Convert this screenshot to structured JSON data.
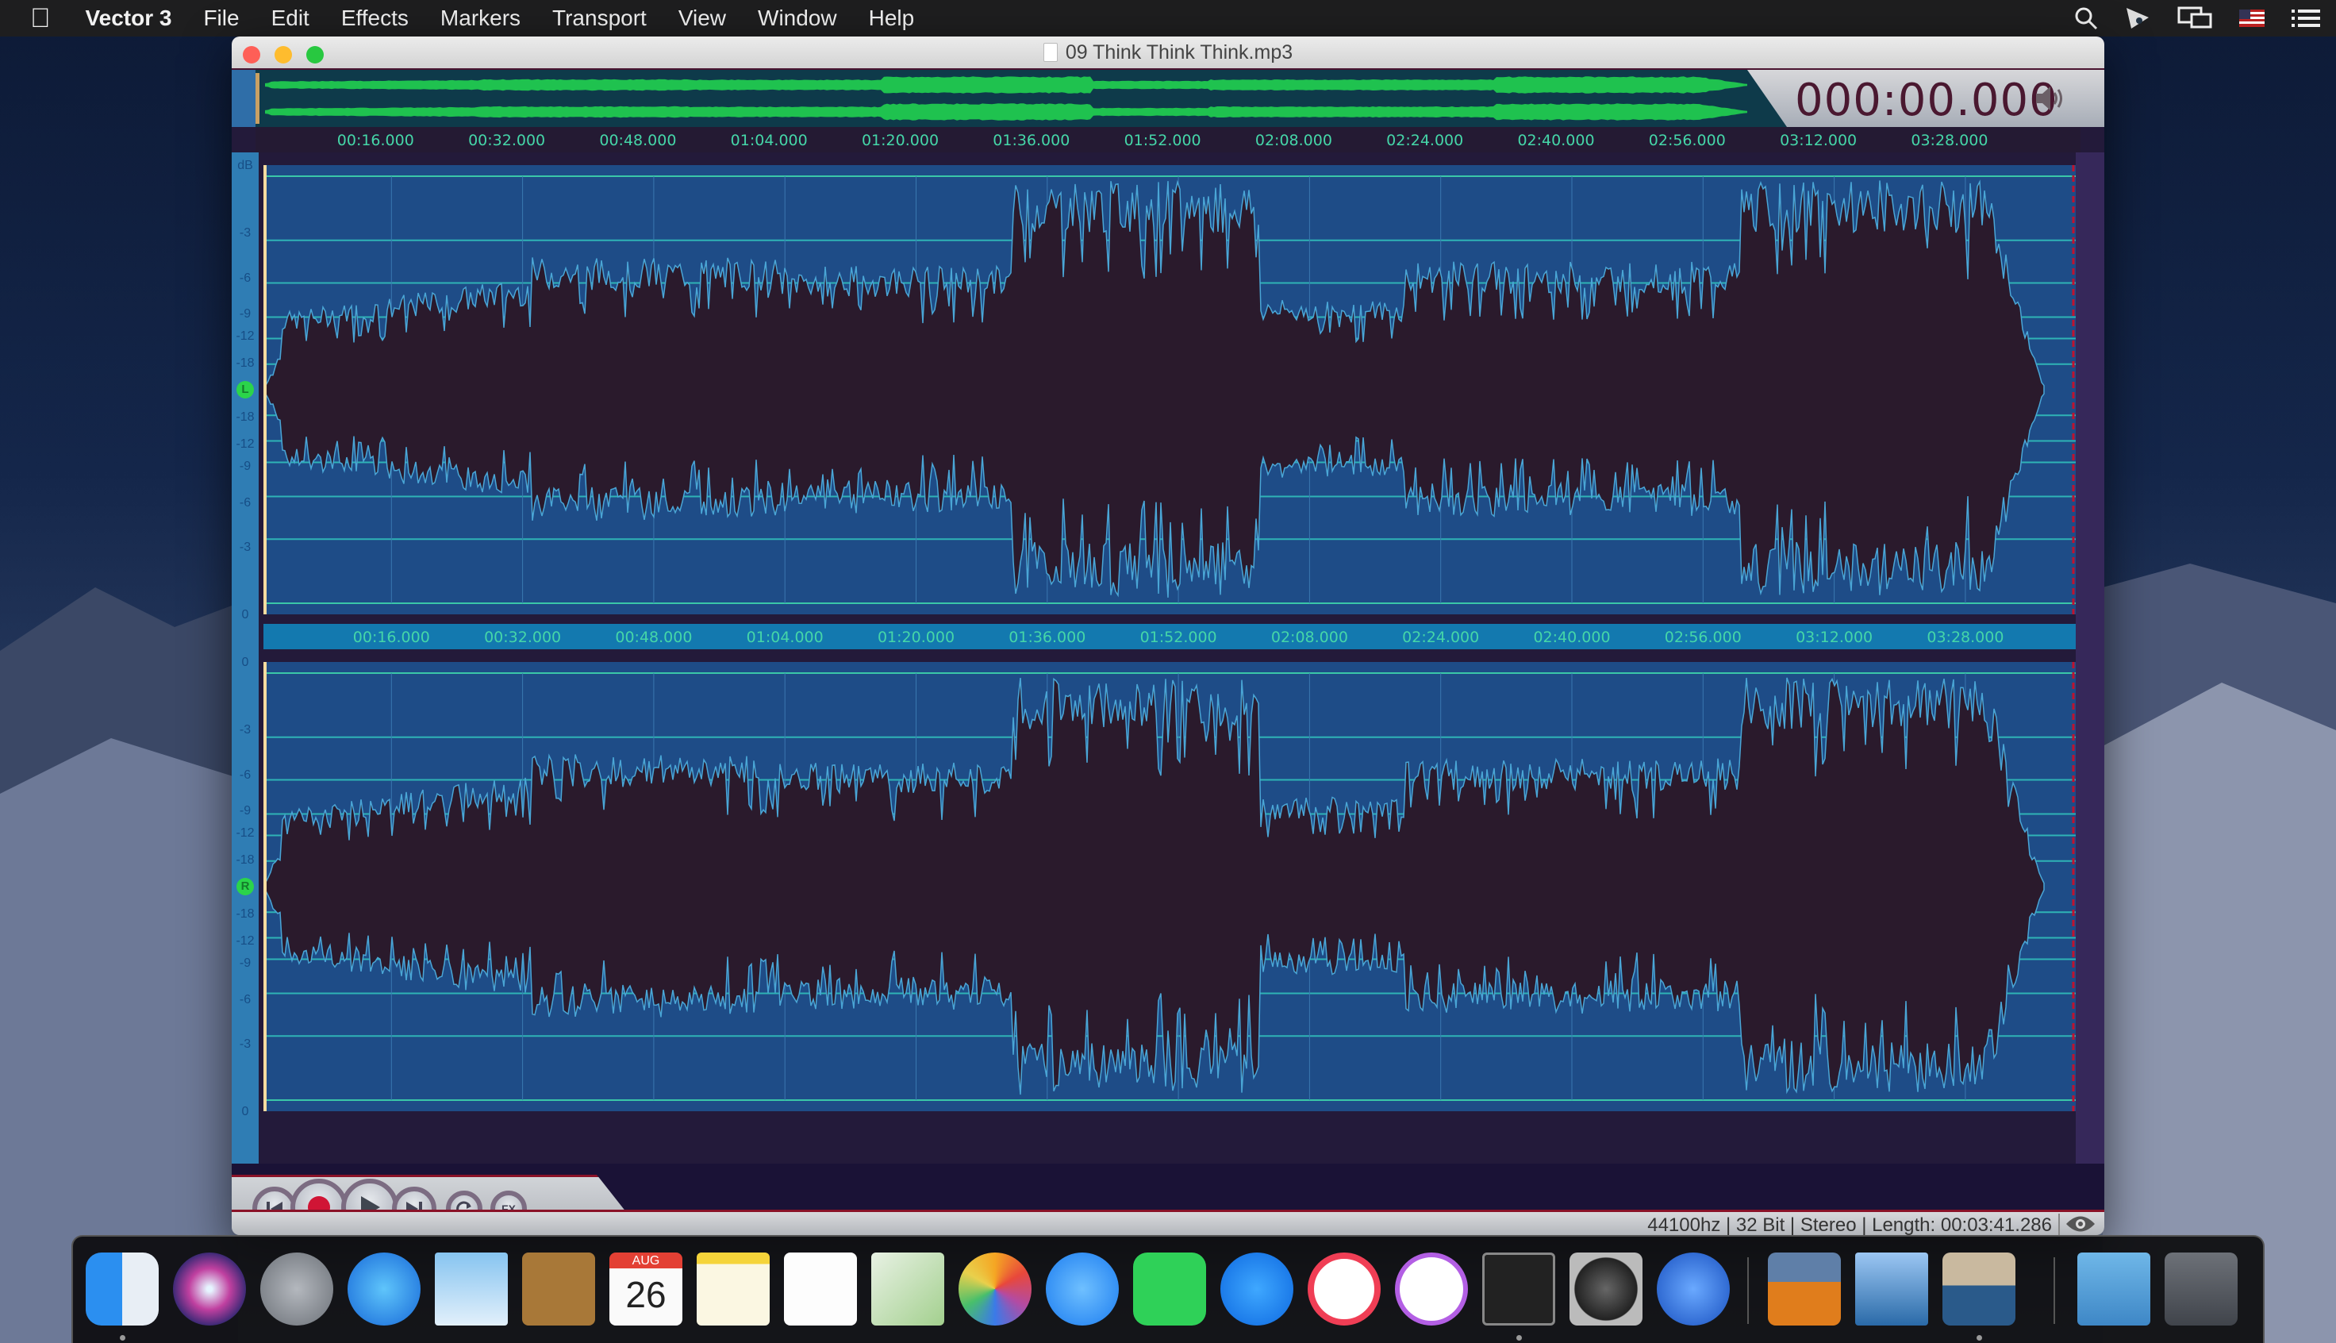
{
  "menubar": {
    "apple_icon": "apple-icon",
    "app_name": "Vector 3",
    "items": [
      "File",
      "Edit",
      "Effects",
      "Markers",
      "Transport",
      "View",
      "Window",
      "Help"
    ],
    "status_icons": [
      "search-icon",
      "airplay-icon",
      "displays-icon",
      "us-flag-icon",
      "list-icon"
    ]
  },
  "window": {
    "title": "09 Think Think Think.mp3",
    "timecode": "000:00.000",
    "volume_icon": "speaker-icon"
  },
  "timeline": {
    "ticks": [
      "00:16.000",
      "00:32.000",
      "00:48.000",
      "01:04.000",
      "01:20.000",
      "01:36.000",
      "01:52.000",
      "02:08.000",
      "02:24.000",
      "02:40.000",
      "02:56.000",
      "03:12.000",
      "03:28.000"
    ],
    "total_seconds": 221.286
  },
  "channels": [
    {
      "label": "L",
      "db_scale": [
        "dB",
        "-3",
        "-6",
        "-9",
        "-12",
        "-18",
        "-18",
        "-12",
        "-9",
        "-6",
        "-3",
        "0"
      ]
    },
    {
      "label": "R",
      "db_scale": [
        "0",
        "-3",
        "-6",
        "-9",
        "-12",
        "-18",
        "-18",
        "-12",
        "-9",
        "-6",
        "-3",
        "0"
      ]
    }
  ],
  "transport": {
    "buttons": [
      {
        "name": "skip-back-button",
        "icon": "skip-back-icon"
      },
      {
        "name": "record-button",
        "icon": "record-icon"
      },
      {
        "name": "play-button",
        "icon": "play-icon"
      },
      {
        "name": "skip-forward-button",
        "icon": "skip-forward-icon"
      },
      {
        "name": "loop-button",
        "icon": "loop-icon"
      },
      {
        "name": "fx-button",
        "icon": "fx-icon",
        "label": "FX"
      }
    ]
  },
  "status": {
    "text": "44100hz | 32 Bit | Stereo | Length: 00:03:41.286",
    "eye_icon": "eye-icon"
  },
  "dock": {
    "apps": [
      {
        "name": "Finder",
        "running": true
      },
      {
        "name": "Siri"
      },
      {
        "name": "Launchpad"
      },
      {
        "name": "Safari"
      },
      {
        "name": "Mail"
      },
      {
        "name": "Contacts"
      },
      {
        "name": "Calendar",
        "month": "AUG",
        "day": "26"
      },
      {
        "name": "Notes"
      },
      {
        "name": "Reminders"
      },
      {
        "name": "Maps"
      },
      {
        "name": "Photos"
      },
      {
        "name": "Messages"
      },
      {
        "name": "FaceTime"
      },
      {
        "name": "App Store"
      },
      {
        "name": "News"
      },
      {
        "name": "iTunes"
      },
      {
        "name": "Terminal",
        "running": true
      },
      {
        "name": "System Preferences"
      },
      {
        "name": "App Cleaner"
      },
      {
        "name": "Archiver"
      },
      {
        "name": "Preview"
      },
      {
        "name": "Vector 3",
        "running": true
      },
      {
        "name": "Downloads Folder"
      },
      {
        "name": "Trash"
      }
    ]
  },
  "colors": {
    "waveform_bg": "#1e4c87",
    "waveform_fill": "#2a1a2c",
    "waveform_edge": "#4aa6d6",
    "overview_wave": "#1fc24f",
    "ruler_text": "#45d6a8",
    "gridline": "#2fb3b6",
    "accent_red": "#c0132f"
  }
}
